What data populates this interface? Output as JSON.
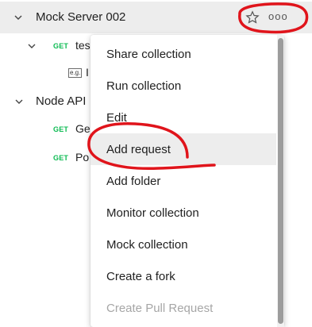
{
  "tree": {
    "mock_server": {
      "name": "Mock Server 002"
    },
    "test_folder": {
      "name_partial": "tes"
    },
    "example": {
      "icon_text": "e.g.",
      "name_partial": "I"
    },
    "node_api": {
      "name": "Node API"
    },
    "req1": {
      "method": "GET",
      "name_partial": "Ge"
    },
    "req2": {
      "method": "GET",
      "name_partial": "Po"
    },
    "more_label": "ooo"
  },
  "context_menu": {
    "items": [
      {
        "label": "Share collection"
      },
      {
        "label": "Run collection"
      },
      {
        "label": "Edit"
      },
      {
        "label": "Add request"
      },
      {
        "label": "Add folder"
      },
      {
        "label": "Monitor collection"
      },
      {
        "label": "Mock collection"
      },
      {
        "label": "Create a fork"
      },
      {
        "label": "Create Pull Request"
      }
    ]
  },
  "icons": {
    "chevron": "chevron-down-icon",
    "star": "star-icon",
    "more": "more-options-icon",
    "example": "example-icon"
  },
  "colors": {
    "method_get": "#0cbb52",
    "annotation": "#e0141b",
    "selected_row": "#ededed",
    "disabled_text": "#a6a6a6"
  }
}
